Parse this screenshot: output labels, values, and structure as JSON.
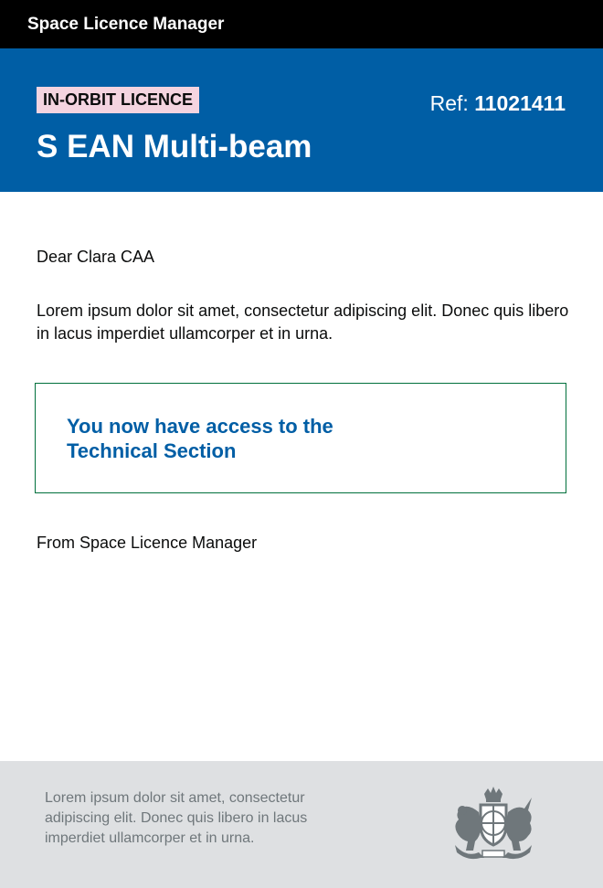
{
  "header": {
    "app_title": "Space Licence Manager"
  },
  "banner": {
    "tag": "IN-ORBIT LICENCE",
    "ref_label": "Ref: ",
    "ref_number": "11021411",
    "licence_name": "S EAN Multi-beam"
  },
  "letter": {
    "dear": "Dear",
    "recipient": "Clara CAA",
    "body": "Lorem ipsum dolor sit amet, consectetur adipiscing elit. Donec quis libero in lacus imperdiet ullamcorper et in urna.",
    "panel_text": "You now have access to the Technical Section",
    "signoff": "From Space Licence Manager"
  },
  "footer": {
    "text": "Lorem ipsum dolor sit amet, consectetur adipiscing elit. Donec quis libero in lacus imperdiet ullamcorper et in urna.",
    "crest_icon": "royal-coat-of-arms-icon"
  },
  "colors": {
    "topbar": "#000000",
    "banner": "#005ea5",
    "tag": "#f4d4e0",
    "panel_border": "#00703c",
    "panel_text": "#005ea5",
    "footer": "#dee0e2"
  }
}
